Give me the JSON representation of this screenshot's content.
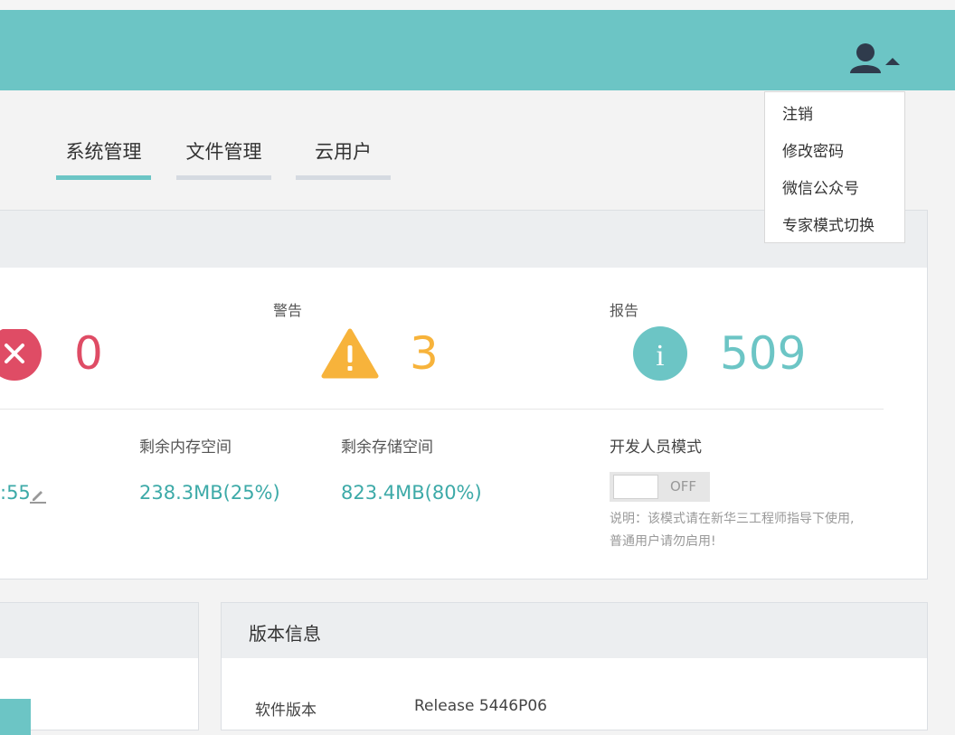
{
  "header": {
    "user_icon": "user-icon",
    "caret_icon": "caret-up-icon",
    "bg_color": "#6cc5c5"
  },
  "user_menu": {
    "items": [
      "注销",
      "修改密码",
      "微信公众号",
      "专家模式切换"
    ]
  },
  "tabs": [
    {
      "label": "系统管理",
      "active": true
    },
    {
      "label": "文件管理",
      "active": false
    },
    {
      "label": "云用户",
      "active": false
    }
  ],
  "status": {
    "errors": {
      "count": "0",
      "icon": "error-x-icon",
      "color": "#df4c65"
    },
    "warnings": {
      "label": "警告",
      "count": "3",
      "icon": "warning-triangle-icon",
      "color": "#f7b33b"
    },
    "reports": {
      "label": "报告",
      "count": "509",
      "icon": "info-icon",
      "color": "#6cc5c5"
    }
  },
  "system_info": {
    "partial_value": ":55",
    "edit_icon": "pencil-icon",
    "free_memory_label": "剩余内存空间",
    "free_memory_value": "238.3MB(25%)",
    "free_storage_label": "剩余存储空间",
    "free_storage_value": "823.4MB(80%)",
    "dev_mode_label": "开发人员模式",
    "dev_mode_toggle": "OFF",
    "dev_mode_note_line1": "说明：该模式请在新华三工程师指导下使用,",
    "dev_mode_note_line2": "普通用户请勿启用!"
  },
  "version_panel": {
    "title": "版本信息",
    "software_version_label": "软件版本",
    "software_version_value": "Release 5446P06"
  }
}
